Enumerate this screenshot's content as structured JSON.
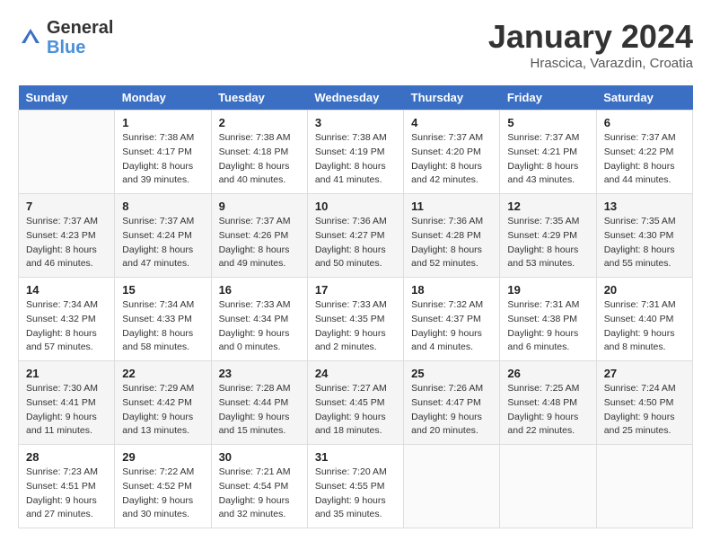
{
  "header": {
    "logo_general": "General",
    "logo_blue": "Blue",
    "month_title": "January 2024",
    "subtitle": "Hrascica, Varazdin, Croatia"
  },
  "days_of_week": [
    "Sunday",
    "Monday",
    "Tuesday",
    "Wednesday",
    "Thursday",
    "Friday",
    "Saturday"
  ],
  "weeks": [
    [
      {
        "day": "",
        "sunrise": "",
        "sunset": "",
        "daylight": ""
      },
      {
        "day": "1",
        "sunrise": "Sunrise: 7:38 AM",
        "sunset": "Sunset: 4:17 PM",
        "daylight": "Daylight: 8 hours and 39 minutes."
      },
      {
        "day": "2",
        "sunrise": "Sunrise: 7:38 AM",
        "sunset": "Sunset: 4:18 PM",
        "daylight": "Daylight: 8 hours and 40 minutes."
      },
      {
        "day": "3",
        "sunrise": "Sunrise: 7:38 AM",
        "sunset": "Sunset: 4:19 PM",
        "daylight": "Daylight: 8 hours and 41 minutes."
      },
      {
        "day": "4",
        "sunrise": "Sunrise: 7:37 AM",
        "sunset": "Sunset: 4:20 PM",
        "daylight": "Daylight: 8 hours and 42 minutes."
      },
      {
        "day": "5",
        "sunrise": "Sunrise: 7:37 AM",
        "sunset": "Sunset: 4:21 PM",
        "daylight": "Daylight: 8 hours and 43 minutes."
      },
      {
        "day": "6",
        "sunrise": "Sunrise: 7:37 AM",
        "sunset": "Sunset: 4:22 PM",
        "daylight": "Daylight: 8 hours and 44 minutes."
      }
    ],
    [
      {
        "day": "7",
        "sunrise": "Sunrise: 7:37 AM",
        "sunset": "Sunset: 4:23 PM",
        "daylight": "Daylight: 8 hours and 46 minutes."
      },
      {
        "day": "8",
        "sunrise": "Sunrise: 7:37 AM",
        "sunset": "Sunset: 4:24 PM",
        "daylight": "Daylight: 8 hours and 47 minutes."
      },
      {
        "day": "9",
        "sunrise": "Sunrise: 7:37 AM",
        "sunset": "Sunset: 4:26 PM",
        "daylight": "Daylight: 8 hours and 49 minutes."
      },
      {
        "day": "10",
        "sunrise": "Sunrise: 7:36 AM",
        "sunset": "Sunset: 4:27 PM",
        "daylight": "Daylight: 8 hours and 50 minutes."
      },
      {
        "day": "11",
        "sunrise": "Sunrise: 7:36 AM",
        "sunset": "Sunset: 4:28 PM",
        "daylight": "Daylight: 8 hours and 52 minutes."
      },
      {
        "day": "12",
        "sunrise": "Sunrise: 7:35 AM",
        "sunset": "Sunset: 4:29 PM",
        "daylight": "Daylight: 8 hours and 53 minutes."
      },
      {
        "day": "13",
        "sunrise": "Sunrise: 7:35 AM",
        "sunset": "Sunset: 4:30 PM",
        "daylight": "Daylight: 8 hours and 55 minutes."
      }
    ],
    [
      {
        "day": "14",
        "sunrise": "Sunrise: 7:34 AM",
        "sunset": "Sunset: 4:32 PM",
        "daylight": "Daylight: 8 hours and 57 minutes."
      },
      {
        "day": "15",
        "sunrise": "Sunrise: 7:34 AM",
        "sunset": "Sunset: 4:33 PM",
        "daylight": "Daylight: 8 hours and 58 minutes."
      },
      {
        "day": "16",
        "sunrise": "Sunrise: 7:33 AM",
        "sunset": "Sunset: 4:34 PM",
        "daylight": "Daylight: 9 hours and 0 minutes."
      },
      {
        "day": "17",
        "sunrise": "Sunrise: 7:33 AM",
        "sunset": "Sunset: 4:35 PM",
        "daylight": "Daylight: 9 hours and 2 minutes."
      },
      {
        "day": "18",
        "sunrise": "Sunrise: 7:32 AM",
        "sunset": "Sunset: 4:37 PM",
        "daylight": "Daylight: 9 hours and 4 minutes."
      },
      {
        "day": "19",
        "sunrise": "Sunrise: 7:31 AM",
        "sunset": "Sunset: 4:38 PM",
        "daylight": "Daylight: 9 hours and 6 minutes."
      },
      {
        "day": "20",
        "sunrise": "Sunrise: 7:31 AM",
        "sunset": "Sunset: 4:40 PM",
        "daylight": "Daylight: 9 hours and 8 minutes."
      }
    ],
    [
      {
        "day": "21",
        "sunrise": "Sunrise: 7:30 AM",
        "sunset": "Sunset: 4:41 PM",
        "daylight": "Daylight: 9 hours and 11 minutes."
      },
      {
        "day": "22",
        "sunrise": "Sunrise: 7:29 AM",
        "sunset": "Sunset: 4:42 PM",
        "daylight": "Daylight: 9 hours and 13 minutes."
      },
      {
        "day": "23",
        "sunrise": "Sunrise: 7:28 AM",
        "sunset": "Sunset: 4:44 PM",
        "daylight": "Daylight: 9 hours and 15 minutes."
      },
      {
        "day": "24",
        "sunrise": "Sunrise: 7:27 AM",
        "sunset": "Sunset: 4:45 PM",
        "daylight": "Daylight: 9 hours and 18 minutes."
      },
      {
        "day": "25",
        "sunrise": "Sunrise: 7:26 AM",
        "sunset": "Sunset: 4:47 PM",
        "daylight": "Daylight: 9 hours and 20 minutes."
      },
      {
        "day": "26",
        "sunrise": "Sunrise: 7:25 AM",
        "sunset": "Sunset: 4:48 PM",
        "daylight": "Daylight: 9 hours and 22 minutes."
      },
      {
        "day": "27",
        "sunrise": "Sunrise: 7:24 AM",
        "sunset": "Sunset: 4:50 PM",
        "daylight": "Daylight: 9 hours and 25 minutes."
      }
    ],
    [
      {
        "day": "28",
        "sunrise": "Sunrise: 7:23 AM",
        "sunset": "Sunset: 4:51 PM",
        "daylight": "Daylight: 9 hours and 27 minutes."
      },
      {
        "day": "29",
        "sunrise": "Sunrise: 7:22 AM",
        "sunset": "Sunset: 4:52 PM",
        "daylight": "Daylight: 9 hours and 30 minutes."
      },
      {
        "day": "30",
        "sunrise": "Sunrise: 7:21 AM",
        "sunset": "Sunset: 4:54 PM",
        "daylight": "Daylight: 9 hours and 32 minutes."
      },
      {
        "day": "31",
        "sunrise": "Sunrise: 7:20 AM",
        "sunset": "Sunset: 4:55 PM",
        "daylight": "Daylight: 9 hours and 35 minutes."
      },
      {
        "day": "",
        "sunrise": "",
        "sunset": "",
        "daylight": ""
      },
      {
        "day": "",
        "sunrise": "",
        "sunset": "",
        "daylight": ""
      },
      {
        "day": "",
        "sunrise": "",
        "sunset": "",
        "daylight": ""
      }
    ]
  ]
}
